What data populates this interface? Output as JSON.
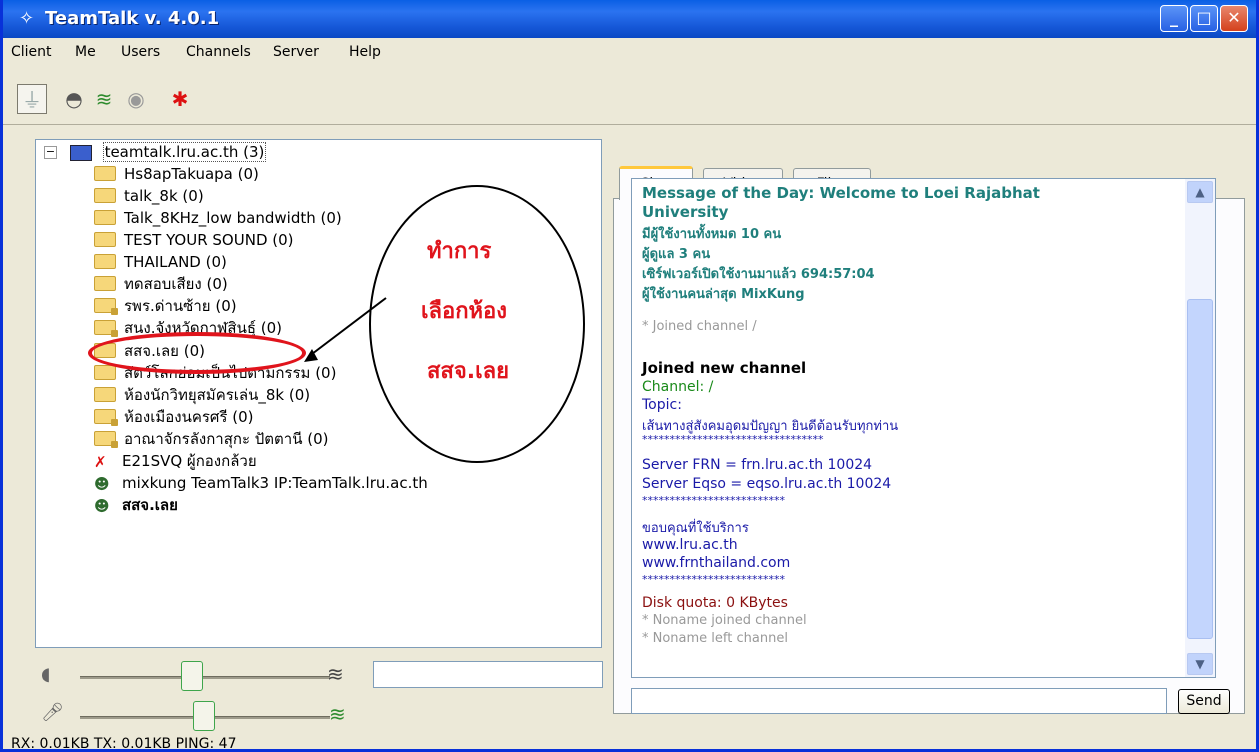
{
  "window": {
    "title": "TeamTalk v. 4.0.1",
    "minimize": "_",
    "maximize": "□",
    "close": "✕"
  },
  "menu": [
    "Client",
    "Me",
    "Users",
    "Channels",
    "Server",
    "Help"
  ],
  "tree": {
    "root": "teamtalk.lru.ac.th (3)",
    "channels": [
      {
        "label": "Hs8apTakuapa (0)",
        "locked": false
      },
      {
        "label": "talk_8k (0)",
        "locked": false
      },
      {
        "label": "Talk_8KHz_low bandwidth (0)",
        "locked": false
      },
      {
        "label": "TEST YOUR SOUND  (0)",
        "locked": false
      },
      {
        "label": "THAILAND (0)",
        "locked": false
      },
      {
        "label": "ทดสอบเสียง (0)",
        "locked": false
      },
      {
        "label": "รพร.ด่านซ้าย (0)",
        "locked": true
      },
      {
        "label": "สนง.จังหวัดกาฬสินธุ์ (0)",
        "locked": true
      },
      {
        "label": "สสจ.เลย (0)",
        "locked": false
      },
      {
        "label": "สัตว์โลกย่อมเป็นไปตามกรรม  (0)",
        "locked": false
      },
      {
        "label": "ห้องนักวิทยุสมัครเล่น_8k (0)",
        "locked": false
      },
      {
        "label": "ห้องเมืองนครศรี (0)",
        "locked": true
      },
      {
        "label": "อาณาจักรลังกาสุกะ  ปัตตานี (0)",
        "locked": true
      }
    ],
    "users": [
      {
        "label": "E21SVQ ผู้กองกล้วย",
        "bold": false
      },
      {
        "label": "mixkung  TeamTalk3  IP:TeamTalk.lru.ac.th",
        "bold": false
      },
      {
        "label": "สสจ.เลย",
        "bold": true
      }
    ]
  },
  "annotation": {
    "line1": "ทำการ",
    "line2": "เลือกห้อง",
    "line3": "สสจ.เลย"
  },
  "tabs": [
    "Chat",
    "Video",
    "Files"
  ],
  "chat": {
    "motd": [
      "Message of the Day: Welcome to Loei Rajabhat",
      "University",
      "มีผู้ใช้งานทั้งหมด 10 คน",
      "ผู้ดูแล 3 คน",
      "เซิร์ฟเวอร์เปิดใช้งานมาแล้ว 694:57:04",
      "ผู้ใช้งานคนล่าสุด MixKung"
    ],
    "joined_slash": "* Joined channel /",
    "joined_new": "Joined new channel",
    "channel": "Channel: /",
    "topic": "Topic:",
    "topic_text": "เส้นทางสู่สังคมอุดมปัญญา ยินดีต้อนรับทุกท่าน",
    "stars1": "*********************************",
    "server_frn": "Server FRN = frn.lru.ac.th 10024",
    "server_eqso": "Server Eqso = eqso.lru.ac.th 10024",
    "stars2": "**************************",
    "thanks": "ขอบคุณที่ใช้บริการ",
    "url1": "www.lru.ac.th",
    "url2": "www.frnthailand.com",
    "stars3": "**************************",
    "disk_quota": "Disk quota: 0 KBytes",
    "noname_joined": "* Noname joined channel",
    "noname_left": "* Noname left channel"
  },
  "send_label": "Send",
  "status": "RX: 0.01KB TX: 0.01KB PING: 47",
  "colors": {
    "motd": "#1f7f7c",
    "channel": "#1a8a1a",
    "topic": "#1a1aa8",
    "disk": "#8b1010",
    "annotation": "#e0141c"
  }
}
